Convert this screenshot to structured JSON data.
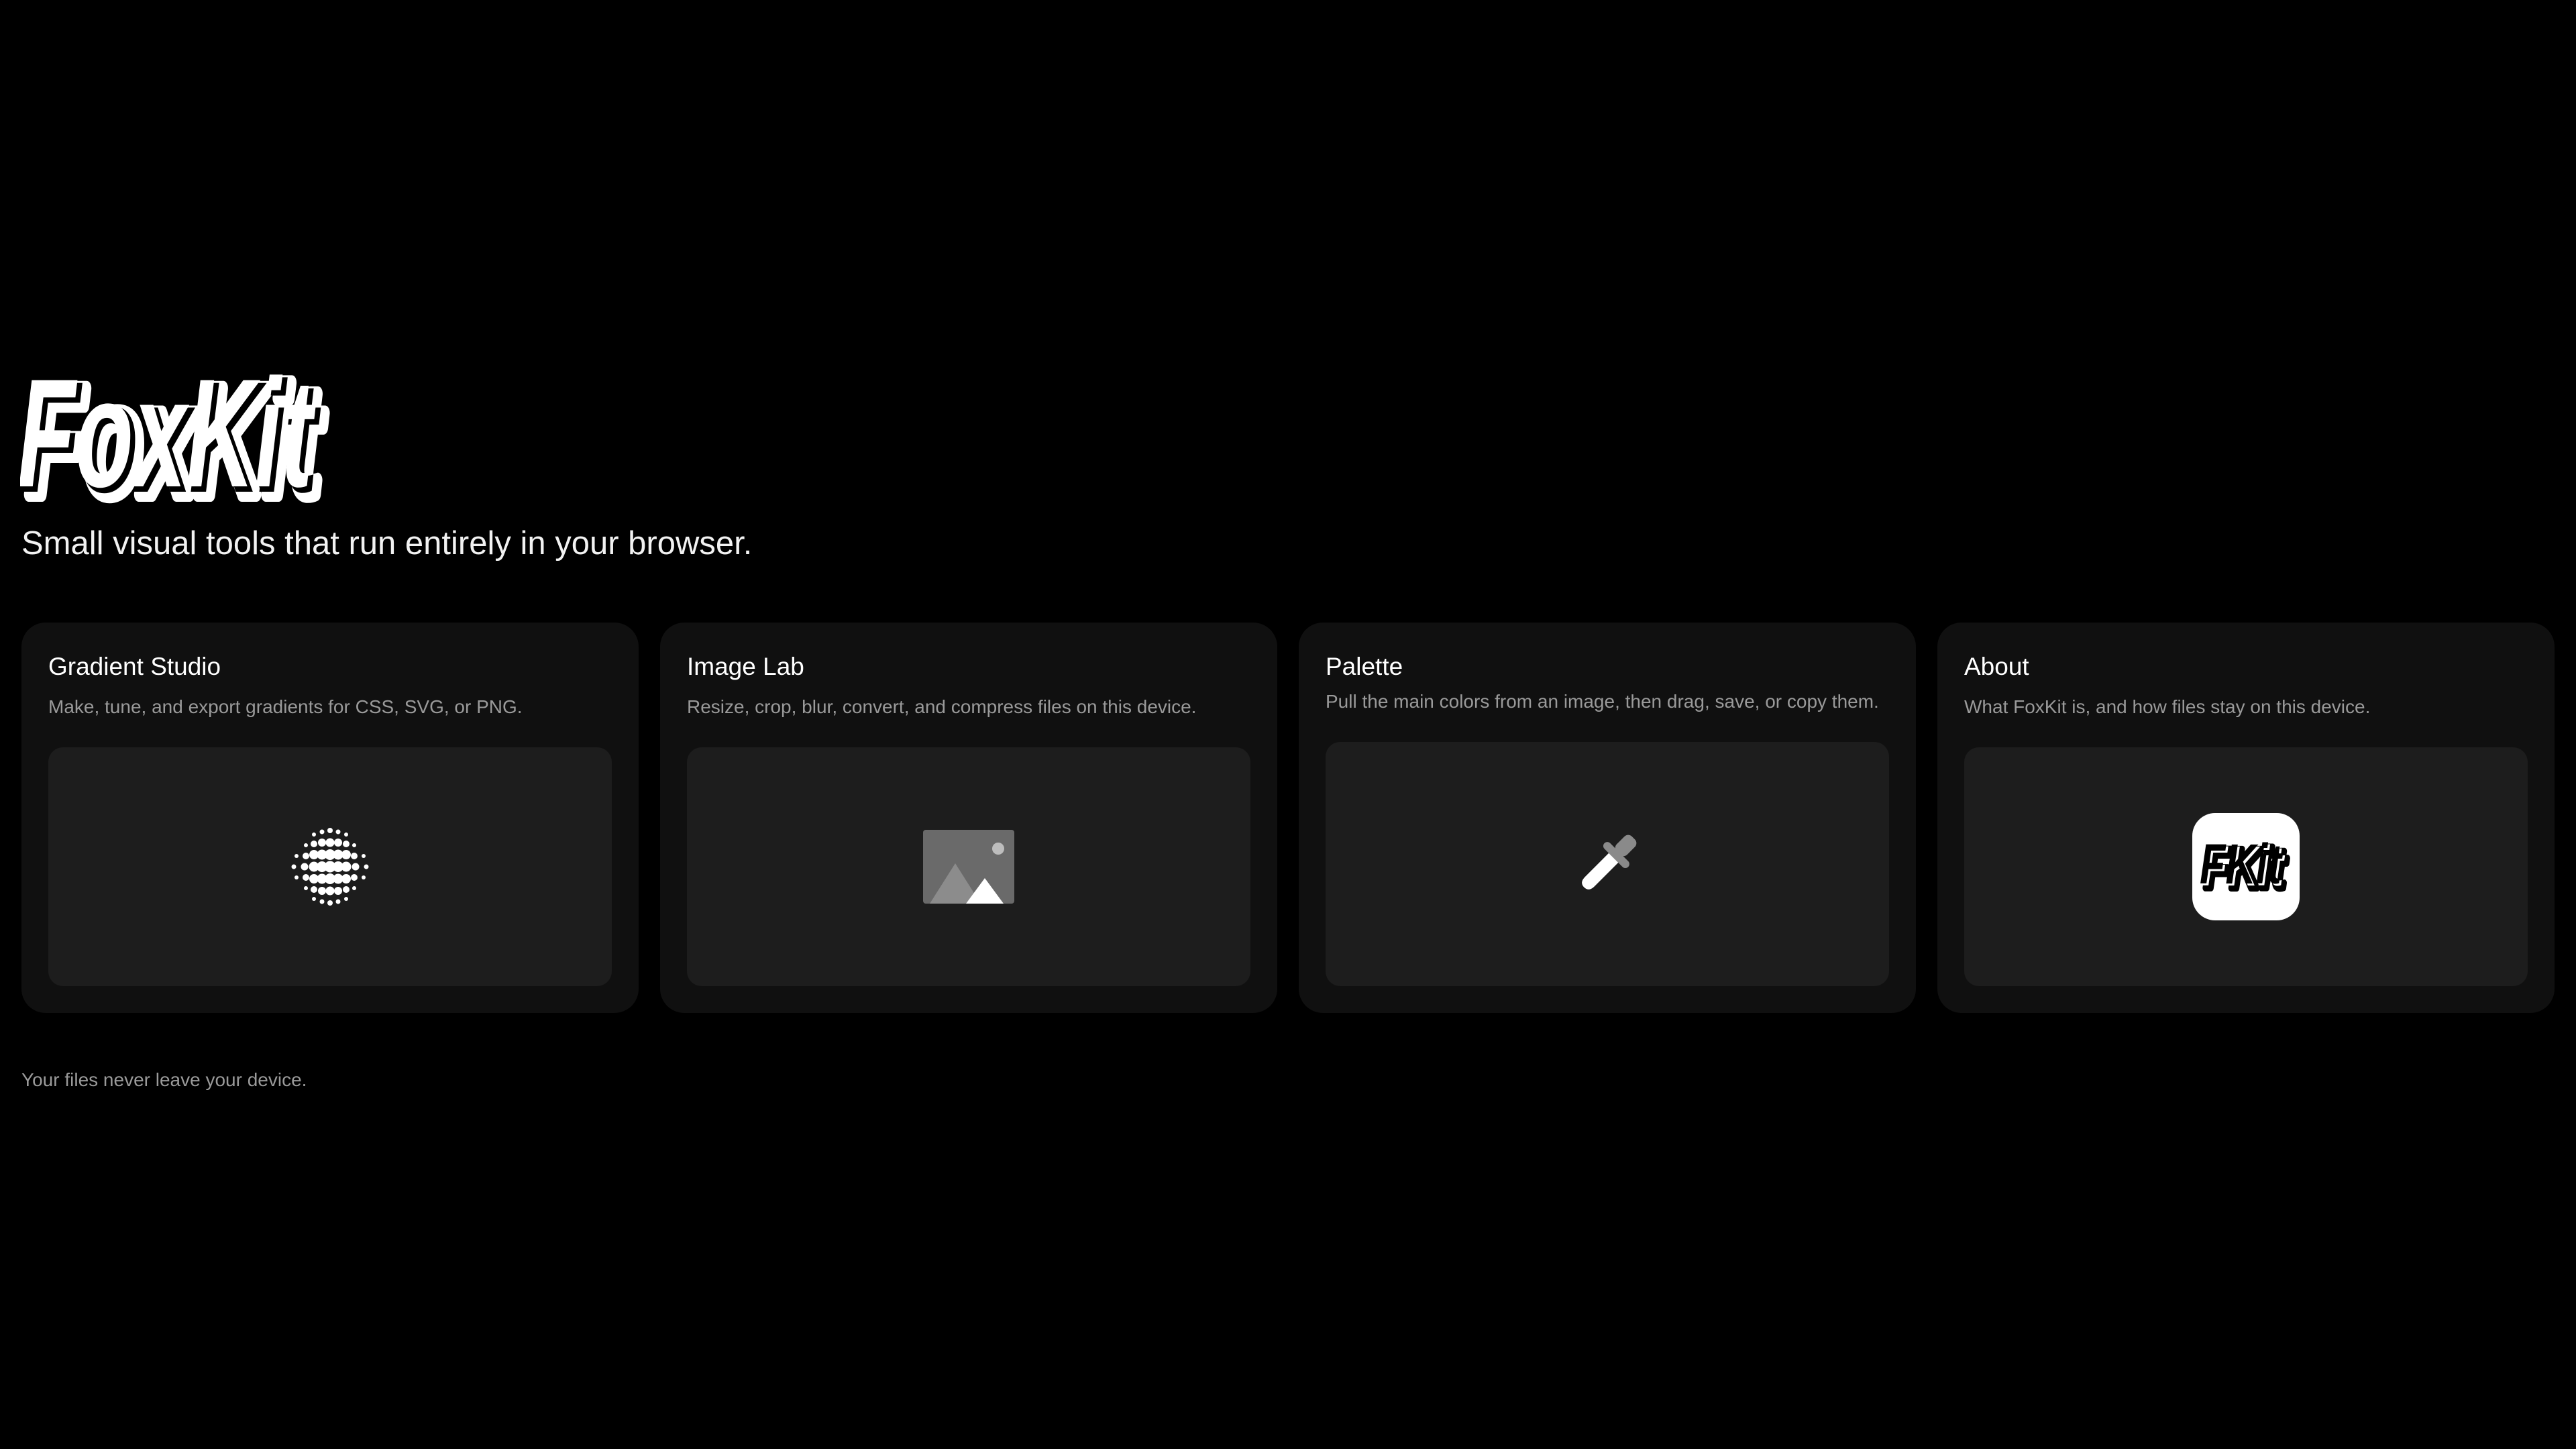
{
  "app": {
    "logo_text": "FoxKit",
    "tagline": "Small visual tools that run entirely in your browser."
  },
  "cards": [
    {
      "title": "Gradient Studio",
      "description": "Make, tune, and export gradients for CSS, SVG, or PNG.",
      "icon": "halftone-dots-icon"
    },
    {
      "title": "Image Lab",
      "description": "Resize, crop, blur, convert, and compress files on this device.",
      "icon": "image-icon"
    },
    {
      "title": "Palette",
      "description": "Pull the main colors from an image, then drag, save, or copy them.",
      "icon": "eyedropper-icon"
    },
    {
      "title": "About",
      "description": "What FoxKit is, and how files stay on this device.",
      "icon": "foxkit-app-icon",
      "icon_text": "FKit"
    }
  ],
  "footer": {
    "note": "Your files never leave your device."
  },
  "colors": {
    "background": "#000000",
    "card": "#101010",
    "preview": "#1d1d1d",
    "muted_text": "#9a9a9a"
  }
}
